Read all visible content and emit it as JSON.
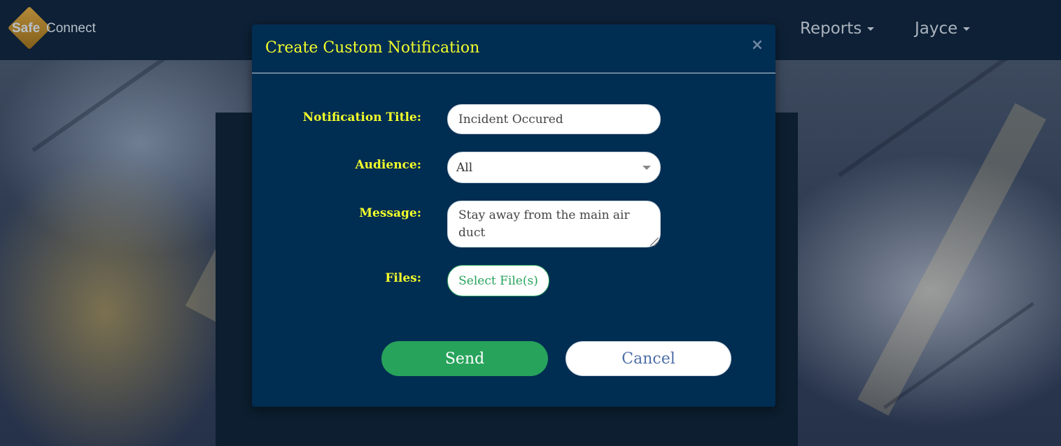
{
  "brand": {
    "logo_text_left": "Safe",
    "logo_text_right": "Connect"
  },
  "navbar": {
    "items": [
      {
        "label": "Reports"
      },
      {
        "label": "Jayce"
      }
    ]
  },
  "modal": {
    "title": "Create Custom Notification",
    "close_symbol": "×",
    "fields": {
      "title_label": "Notification Title:",
      "title_value": "Incident Occured",
      "audience_label": "Audience:",
      "audience_value": "All",
      "message_label": "Message:",
      "message_value": "Stay away from the main air duct",
      "files_label": "Files:",
      "files_button": "Select File(s)"
    },
    "actions": {
      "send_label": "Send",
      "cancel_label": "Cancel"
    }
  },
  "colors": {
    "navbar_bg": "#0d2035",
    "modal_bg": "#002d52",
    "label_yellow": "#f3ff2a",
    "accent_green": "#27a35b",
    "cancel_text": "#4e6fa8"
  }
}
